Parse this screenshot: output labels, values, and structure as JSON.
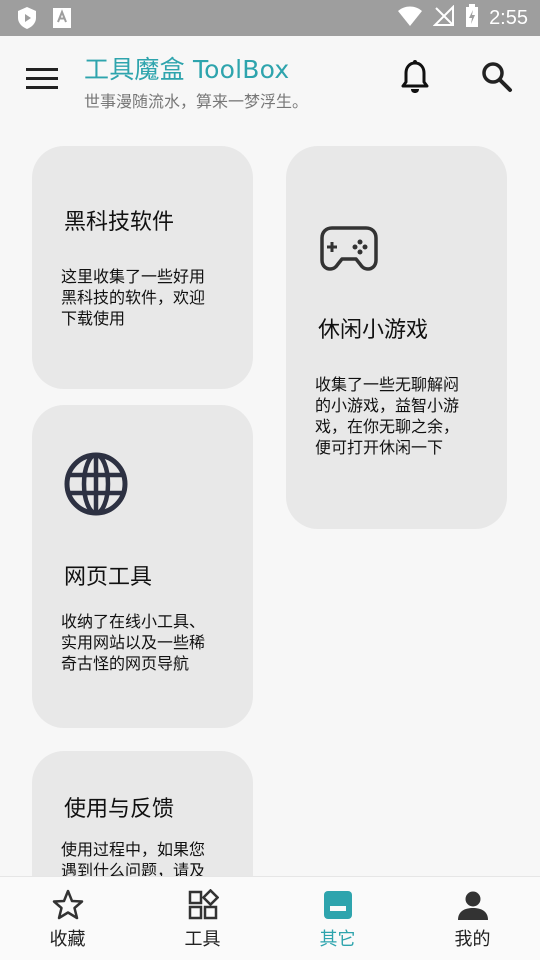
{
  "status_bar": {
    "time": "2:55"
  },
  "header": {
    "title": "工具魔盒 ToolBox",
    "subtitle": "世事漫随流水，算来一梦浮生。"
  },
  "cards": [
    {
      "title": "黑科技软件",
      "desc_lines": [
        "这里收集了一些好用",
        "黑科技的软件，欢迎",
        "下载使用"
      ]
    },
    {
      "title": "休闲小游戏",
      "icon": "gamepad-icon",
      "desc_lines": [
        "收集了一些无聊解闷",
        "的小游戏，益智小游",
        "戏，在你无聊之余，",
        "便可打开休闲一下"
      ]
    },
    {
      "title": "网页工具",
      "icon": "globe-icon",
      "desc_lines": [
        "收纳了在线小工具、",
        "实用网站以及一些稀",
        "奇古怪的网页导航"
      ]
    },
    {
      "title": "使用与反馈",
      "desc_lines": [
        "使用过程中，如果您",
        "遇到什么问题，请及"
      ]
    }
  ],
  "bottom_nav": {
    "active_index": 2,
    "active_color": "#2ea4ad",
    "items": [
      {
        "label": "收藏",
        "icon": "star-icon"
      },
      {
        "label": "工具",
        "icon": "apps-icon"
      },
      {
        "label": "其它",
        "icon": "folder-icon"
      },
      {
        "label": "我的",
        "icon": "person-icon"
      }
    ]
  },
  "colors": {
    "accent": "#2ea4ad",
    "card_bg": "#e8e8e8",
    "status_bar_bg": "#9e9e9e"
  }
}
